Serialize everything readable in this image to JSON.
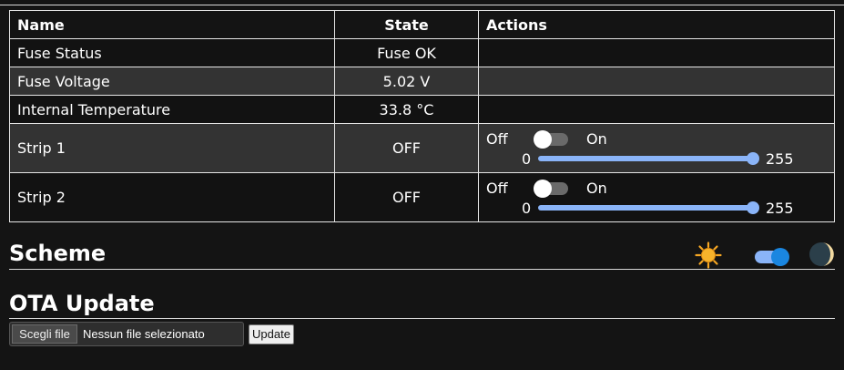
{
  "table": {
    "headers": {
      "name": "Name",
      "state": "State",
      "actions": "Actions"
    },
    "rows": [
      {
        "name": "Fuse Status",
        "state": "Fuse OK"
      },
      {
        "name": "Fuse Voltage",
        "state": "5.02 V"
      },
      {
        "name": "Internal Temperature",
        "state": "33.8 °C"
      },
      {
        "name": "Strip 1",
        "state": "OFF",
        "off_label": "Off",
        "on_label": "On",
        "switch_on": false,
        "slider_min": "0",
        "slider_max": "255",
        "slider_value": 255
      },
      {
        "name": "Strip 2",
        "state": "OFF",
        "off_label": "Off",
        "on_label": "On",
        "switch_on": false,
        "slider_min": "0",
        "slider_max": "255",
        "slider_value": 255
      }
    ]
  },
  "scheme": {
    "title": "Scheme",
    "light_icon": "sun-icon",
    "dark_icon": "moon-icon",
    "dark_mode_on": true
  },
  "ota": {
    "title": "OTA Update",
    "choose_file_label": "Scegli file",
    "no_file_text": "Nessun file selezionato",
    "update_label": "Update"
  },
  "colors": {
    "background": "#141414",
    "row_alt": "#333333",
    "accent": "#8ab4f8",
    "toggle_knob_on": "#1a86e0"
  }
}
